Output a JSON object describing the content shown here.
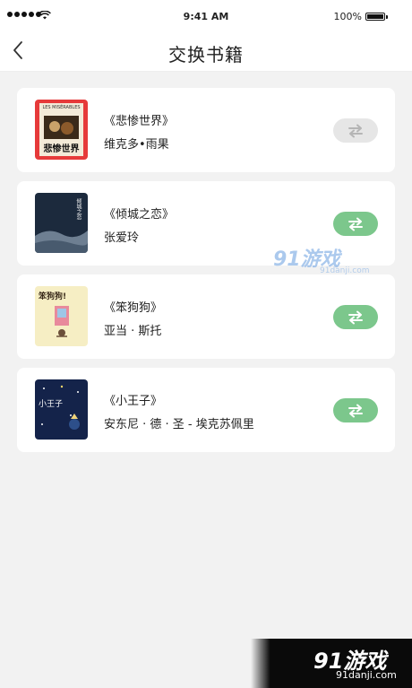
{
  "status_bar": {
    "time": "9:41 AM",
    "battery": "100%"
  },
  "nav": {
    "title": "交换书籍",
    "back_icon": "chevron-left-icon"
  },
  "books": [
    {
      "title": "《悲惨世界》",
      "author": "维克多•雨果",
      "swap_state": "disabled",
      "cover_text": "悲惨世界",
      "cover_subtext": "LES MISÉRABLES"
    },
    {
      "title": "《倾城之恋》",
      "author": "张爱玲",
      "swap_state": "enabled",
      "cover_text": "倾城之恋"
    },
    {
      "title": "《笨狗狗》",
      "author": "亚当 · 斯托",
      "swap_state": "enabled",
      "cover_text": "笨狗狗!"
    },
    {
      "title": "《小王子》",
      "author": "安东尼 · 德 · 圣 - 埃克苏佩里",
      "swap_state": "enabled",
      "cover_text": "小王子"
    }
  ],
  "colors": {
    "swap_enabled": "#7cc78c",
    "swap_disabled": "#e6e6e6",
    "background": "#f2f2f2"
  },
  "watermark": {
    "logo": "91游戏",
    "url": "91danji.com"
  }
}
